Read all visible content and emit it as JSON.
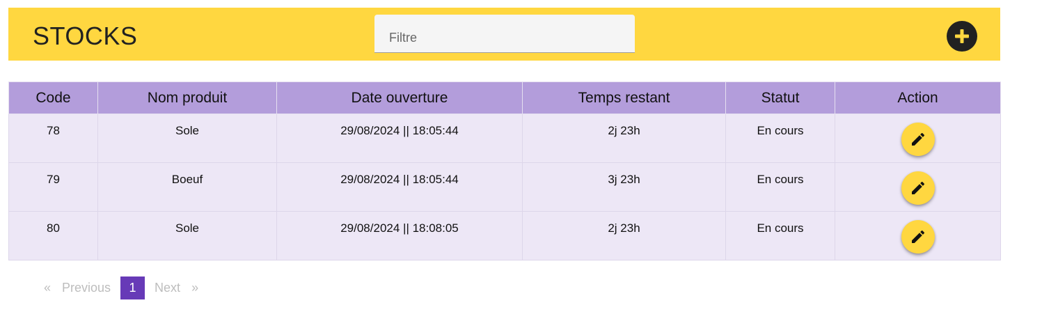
{
  "header": {
    "title": "STOCKS",
    "filter_placeholder": "Filtre",
    "add_icon": "plus-circle-icon"
  },
  "table": {
    "columns": [
      "Code",
      "Nom produit",
      "Date ouverture",
      "Temps restant",
      "Statut",
      "Action"
    ],
    "rows": [
      {
        "code": "78",
        "nom": "Sole",
        "date": "29/08/2024 || 18:05:44",
        "temps": "2j 23h",
        "statut": "En cours"
      },
      {
        "code": "79",
        "nom": "Boeuf",
        "date": "29/08/2024 || 18:05:44",
        "temps": "3j 23h",
        "statut": "En cours"
      },
      {
        "code": "80",
        "nom": "Sole",
        "date": "29/08/2024 || 18:08:05",
        "temps": "2j 23h",
        "statut": "En cours"
      }
    ],
    "action_icon": "pencil-icon"
  },
  "pagination": {
    "first": "«",
    "previous": "Previous",
    "current": "1",
    "next": "Next",
    "last": "»"
  },
  "colors": {
    "header": "#ffd740",
    "table_header": "#b39ddb",
    "table_row": "#ede7f6",
    "page_active": "#673ab7"
  }
}
